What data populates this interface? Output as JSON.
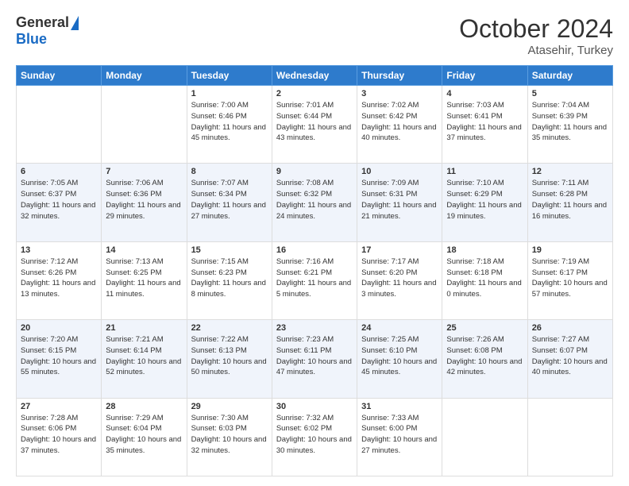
{
  "header": {
    "logo_general": "General",
    "logo_blue": "Blue",
    "month_title": "October 2024",
    "subtitle": "Atasehir, Turkey"
  },
  "weekdays": [
    "Sunday",
    "Monday",
    "Tuesday",
    "Wednesday",
    "Thursday",
    "Friday",
    "Saturday"
  ],
  "weeks": [
    [
      {
        "day": "",
        "info": ""
      },
      {
        "day": "",
        "info": ""
      },
      {
        "day": "1",
        "info": "Sunrise: 7:00 AM\nSunset: 6:46 PM\nDaylight: 11 hours and 45 minutes."
      },
      {
        "day": "2",
        "info": "Sunrise: 7:01 AM\nSunset: 6:44 PM\nDaylight: 11 hours and 43 minutes."
      },
      {
        "day": "3",
        "info": "Sunrise: 7:02 AM\nSunset: 6:42 PM\nDaylight: 11 hours and 40 minutes."
      },
      {
        "day": "4",
        "info": "Sunrise: 7:03 AM\nSunset: 6:41 PM\nDaylight: 11 hours and 37 minutes."
      },
      {
        "day": "5",
        "info": "Sunrise: 7:04 AM\nSunset: 6:39 PM\nDaylight: 11 hours and 35 minutes."
      }
    ],
    [
      {
        "day": "6",
        "info": "Sunrise: 7:05 AM\nSunset: 6:37 PM\nDaylight: 11 hours and 32 minutes."
      },
      {
        "day": "7",
        "info": "Sunrise: 7:06 AM\nSunset: 6:36 PM\nDaylight: 11 hours and 29 minutes."
      },
      {
        "day": "8",
        "info": "Sunrise: 7:07 AM\nSunset: 6:34 PM\nDaylight: 11 hours and 27 minutes."
      },
      {
        "day": "9",
        "info": "Sunrise: 7:08 AM\nSunset: 6:32 PM\nDaylight: 11 hours and 24 minutes."
      },
      {
        "day": "10",
        "info": "Sunrise: 7:09 AM\nSunset: 6:31 PM\nDaylight: 11 hours and 21 minutes."
      },
      {
        "day": "11",
        "info": "Sunrise: 7:10 AM\nSunset: 6:29 PM\nDaylight: 11 hours and 19 minutes."
      },
      {
        "day": "12",
        "info": "Sunrise: 7:11 AM\nSunset: 6:28 PM\nDaylight: 11 hours and 16 minutes."
      }
    ],
    [
      {
        "day": "13",
        "info": "Sunrise: 7:12 AM\nSunset: 6:26 PM\nDaylight: 11 hours and 13 minutes."
      },
      {
        "day": "14",
        "info": "Sunrise: 7:13 AM\nSunset: 6:25 PM\nDaylight: 11 hours and 11 minutes."
      },
      {
        "day": "15",
        "info": "Sunrise: 7:15 AM\nSunset: 6:23 PM\nDaylight: 11 hours and 8 minutes."
      },
      {
        "day": "16",
        "info": "Sunrise: 7:16 AM\nSunset: 6:21 PM\nDaylight: 11 hours and 5 minutes."
      },
      {
        "day": "17",
        "info": "Sunrise: 7:17 AM\nSunset: 6:20 PM\nDaylight: 11 hours and 3 minutes."
      },
      {
        "day": "18",
        "info": "Sunrise: 7:18 AM\nSunset: 6:18 PM\nDaylight: 11 hours and 0 minutes."
      },
      {
        "day": "19",
        "info": "Sunrise: 7:19 AM\nSunset: 6:17 PM\nDaylight: 10 hours and 57 minutes."
      }
    ],
    [
      {
        "day": "20",
        "info": "Sunrise: 7:20 AM\nSunset: 6:15 PM\nDaylight: 10 hours and 55 minutes."
      },
      {
        "day": "21",
        "info": "Sunrise: 7:21 AM\nSunset: 6:14 PM\nDaylight: 10 hours and 52 minutes."
      },
      {
        "day": "22",
        "info": "Sunrise: 7:22 AM\nSunset: 6:13 PM\nDaylight: 10 hours and 50 minutes."
      },
      {
        "day": "23",
        "info": "Sunrise: 7:23 AM\nSunset: 6:11 PM\nDaylight: 10 hours and 47 minutes."
      },
      {
        "day": "24",
        "info": "Sunrise: 7:25 AM\nSunset: 6:10 PM\nDaylight: 10 hours and 45 minutes."
      },
      {
        "day": "25",
        "info": "Sunrise: 7:26 AM\nSunset: 6:08 PM\nDaylight: 10 hours and 42 minutes."
      },
      {
        "day": "26",
        "info": "Sunrise: 7:27 AM\nSunset: 6:07 PM\nDaylight: 10 hours and 40 minutes."
      }
    ],
    [
      {
        "day": "27",
        "info": "Sunrise: 7:28 AM\nSunset: 6:06 PM\nDaylight: 10 hours and 37 minutes."
      },
      {
        "day": "28",
        "info": "Sunrise: 7:29 AM\nSunset: 6:04 PM\nDaylight: 10 hours and 35 minutes."
      },
      {
        "day": "29",
        "info": "Sunrise: 7:30 AM\nSunset: 6:03 PM\nDaylight: 10 hours and 32 minutes."
      },
      {
        "day": "30",
        "info": "Sunrise: 7:32 AM\nSunset: 6:02 PM\nDaylight: 10 hours and 30 minutes."
      },
      {
        "day": "31",
        "info": "Sunrise: 7:33 AM\nSunset: 6:00 PM\nDaylight: 10 hours and 27 minutes."
      },
      {
        "day": "",
        "info": ""
      },
      {
        "day": "",
        "info": ""
      }
    ]
  ]
}
